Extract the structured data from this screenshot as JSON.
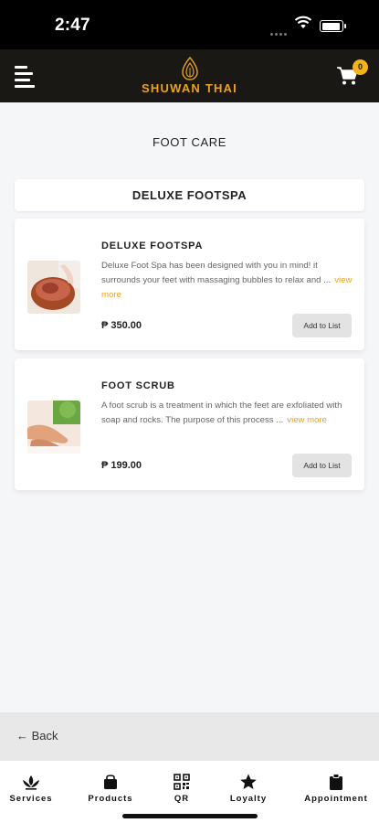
{
  "status_bar": {
    "time": "2:47"
  },
  "header": {
    "brand": "SHUWAN THAI",
    "cart_count": "0"
  },
  "page": {
    "title": "FOOT CARE",
    "subcategory": "DELUXE FOOTSPA"
  },
  "products": [
    {
      "name": "DELUXE FOOTSPA",
      "description": "Deluxe Foot Spa has been designed with you in mind! it surrounds your feet with massaging bubbles to relax and ...",
      "view_more": "view more",
      "price": "₱ 350.00",
      "button": "Add to List"
    },
    {
      "name": "FOOT SCRUB",
      "description": "A foot scrub is a treatment in which the feet are exfoliated with soap and rocks. The purpose of this process ...",
      "view_more": "view more",
      "price": "₱ 199.00",
      "button": "Add to List"
    }
  ],
  "back": {
    "label": "Back"
  },
  "bottom_nav": [
    {
      "label": "Services",
      "icon": "lotus-icon"
    },
    {
      "label": "Products",
      "icon": "bag-icon"
    },
    {
      "label": "QR",
      "icon": "qr-icon"
    },
    {
      "label": "Loyalty",
      "icon": "star-icon"
    },
    {
      "label": "Appointment",
      "icon": "clipboard-icon"
    }
  ],
  "colors": {
    "accent": "#e7a321",
    "header_bg": "#1a1815",
    "badge": "#f2b21b"
  }
}
